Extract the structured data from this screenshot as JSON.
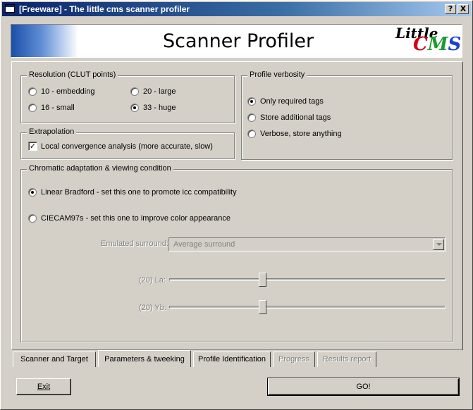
{
  "window": {
    "title": "[Freeware] - The little cms scanner profiler",
    "help_button": "?",
    "close_button": "X"
  },
  "banner": {
    "title": "Scanner Profiler",
    "logo_little": "Little",
    "logo_c": "C",
    "logo_m": "M",
    "logo_s": "S"
  },
  "resolution": {
    "legend": "Resolution (CLUT points)",
    "options": [
      {
        "label": "10 - embedding",
        "selected": false
      },
      {
        "label": "20 - large",
        "selected": false
      },
      {
        "label": "16 - small",
        "selected": false
      },
      {
        "label": "33 - huge",
        "selected": true
      }
    ]
  },
  "extrapolation": {
    "legend": "Extrapolation",
    "checkbox_label": "Local convergence analysis (more accurate, slow)",
    "checked": true
  },
  "verbosity": {
    "legend": "Profile verbosity",
    "options": [
      {
        "label": "Only required tags",
        "selected": true
      },
      {
        "label": "Store additional tags",
        "selected": false
      },
      {
        "label": "Verbose, store anything",
        "selected": false
      }
    ]
  },
  "chromatic": {
    "legend": "Chromatic adaptation & viewing condition",
    "options": [
      {
        "label": "Linear Bradford - set this one to promote icc compatibility",
        "selected": true
      },
      {
        "label": "CIECAM97s - set this one to improve color appearance",
        "selected": false
      }
    ],
    "surround_label": "Emulated surround:",
    "surround_value": "Average surround",
    "la_label": "(20) La:",
    "la_value": 20,
    "yb_label": "(20) Yb:",
    "yb_value": 20
  },
  "tabs": [
    {
      "label": "Scanner and Target",
      "active": false,
      "enabled": true
    },
    {
      "label": "Parameters & tweeking",
      "active": true,
      "enabled": true
    },
    {
      "label": "Profile Identification",
      "active": false,
      "enabled": true
    },
    {
      "label": "Progress",
      "active": false,
      "enabled": false
    },
    {
      "label": "Results report",
      "active": false,
      "enabled": false
    }
  ],
  "buttons": {
    "exit": "Exit",
    "go": "GO!"
  }
}
